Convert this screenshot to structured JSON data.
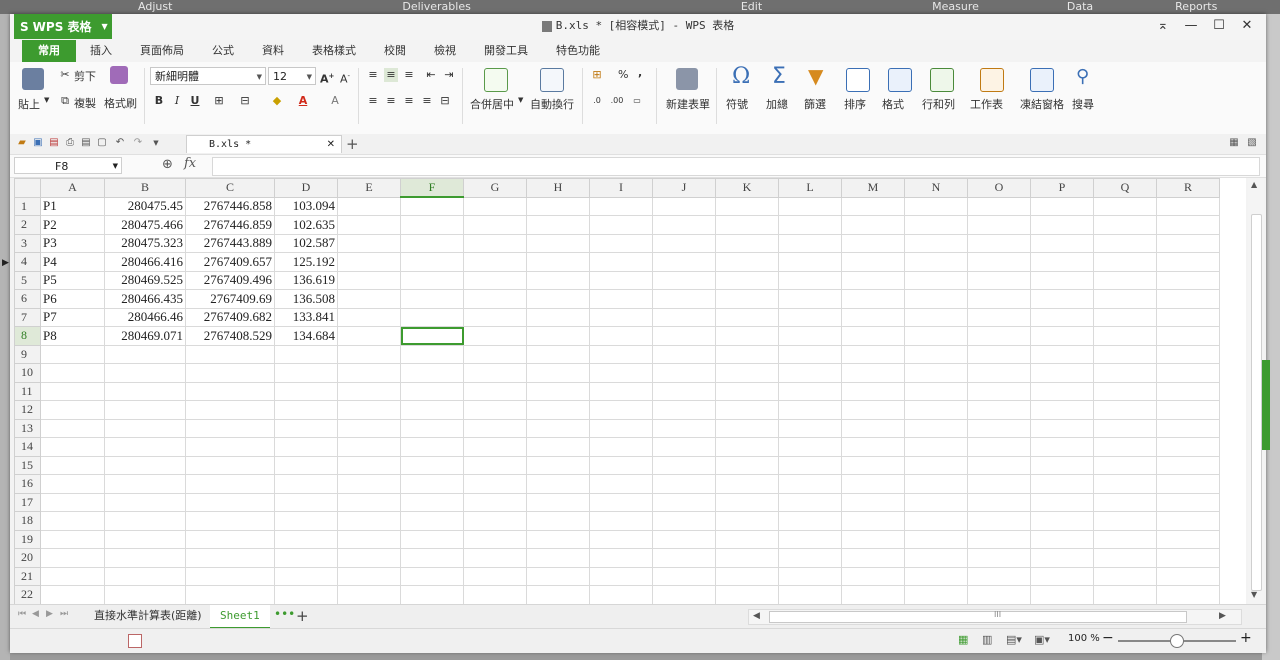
{
  "background_app": {
    "menu": [
      "Adjust",
      "Deliverables",
      "Edit",
      "Measure",
      "Data",
      "Reports"
    ]
  },
  "titlebar": {
    "app_button": "WPS 表格",
    "title": "B.xls * [相容模式] - WPS 表格"
  },
  "ribbon_tabs": [
    "常用",
    "插入",
    "頁面佈局",
    "公式",
    "資料",
    "表格樣式",
    "校閱",
    "檢視",
    "開發工具",
    "特色功能"
  ],
  "ribbon": {
    "paste": "貼上",
    "cut": "剪下",
    "copy": "複製",
    "format_painter": "格式刷",
    "font_name": "新細明體",
    "font_size": "12",
    "merge_center": "合併居中",
    "wrap_text": "自動換行",
    "new_table_style": "新建表單",
    "symbol": "符號",
    "sum": "加總",
    "filter": "篩選",
    "sort": "排序",
    "format": "格式",
    "row_col": "行和列",
    "worksheet": "工作表",
    "freeze": "凍結窗格",
    "find": "搜尋",
    "percent": "%",
    "comma": ","
  },
  "doc_tab": {
    "name": "B.xls *"
  },
  "formula_bar": {
    "cell_ref": "F8",
    "fx": "fx",
    "content": ""
  },
  "sheet": {
    "columns": [
      "A",
      "B",
      "C",
      "D",
      "E",
      "F",
      "G",
      "H",
      "I",
      "J",
      "K",
      "L",
      "M",
      "N",
      "O",
      "P",
      "Q",
      "R"
    ],
    "row_numbers": [
      "1",
      "2",
      "3",
      "4",
      "5",
      "6",
      "7",
      "8",
      "9",
      "10",
      "11",
      "12",
      "13",
      "14",
      "15",
      "16",
      "17",
      "18",
      "19",
      "20",
      "21",
      "22"
    ],
    "selected_column": "F",
    "selected_row": "8",
    "rows": [
      [
        "P1",
        "280475.45",
        "2767446.858",
        "103.094"
      ],
      [
        "P2",
        "280475.466",
        "2767446.859",
        "102.635"
      ],
      [
        "P3",
        "280475.323",
        "2767443.889",
        "102.587"
      ],
      [
        "P4",
        "280466.416",
        "2767409.657",
        "125.192"
      ],
      [
        "P5",
        "280469.525",
        "2767409.496",
        "136.619"
      ],
      [
        "P6",
        "280466.435",
        "2767409.69",
        "136.508"
      ],
      [
        "P7",
        "280466.46",
        "2767409.682",
        "133.841"
      ],
      [
        "P8",
        "280469.071",
        "2767408.529",
        "134.684"
      ]
    ]
  },
  "sheet_tabs": [
    "直接水準計算表(距離)",
    "Sheet1"
  ],
  "status": {
    "zoom": "100 %"
  }
}
